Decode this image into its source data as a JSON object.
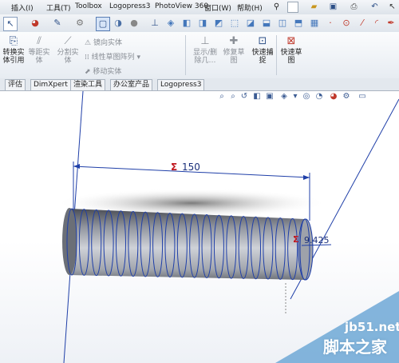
{
  "menu": {
    "items": [
      "插入(I)",
      "工具(T)",
      "Toolbox",
      "Logopress3",
      "PhotoView 360",
      "窗口(W)",
      "帮助(H)"
    ]
  },
  "quick_access": {
    "icons": [
      "pin-icon",
      "new-file-icon",
      "open-folder-icon",
      "save-icon",
      "print-icon",
      "undo-icon",
      "select-icon"
    ]
  },
  "toolbar": {
    "icons": [
      "select-arrow-icon",
      "appearance-icon",
      "smart-dim-icon",
      "rebuild-icon",
      "display-mode-icon",
      "shaded-icon",
      "view-orient-icon",
      "cube-icon",
      "section-icon",
      "point-icon",
      "circle-icon",
      "line-icon",
      "arc-icon",
      "pen-icon"
    ]
  },
  "ribbon": {
    "convert": "转换实\n体引用",
    "offset": "等距实\n体",
    "split": "分割实\n体",
    "mirror": "镜向实体",
    "linear_pattern": "线性草图阵列",
    "move": "移动实体",
    "show_hide": "显示/删\n除几…",
    "repair": "修复草\n图",
    "quick_snap": "快速捕\n捉",
    "quick_sketch": "快速草\n图"
  },
  "tabs": [
    "评估",
    "DimXpert",
    "渲染工具",
    "办公室产品",
    "Logopress3"
  ],
  "viewport": {
    "dim_length": "150",
    "dim_diameter": "9.425",
    "sigma": "Σ"
  },
  "watermark": {
    "line1": "jb51.net",
    "line2": "脚本之家"
  }
}
